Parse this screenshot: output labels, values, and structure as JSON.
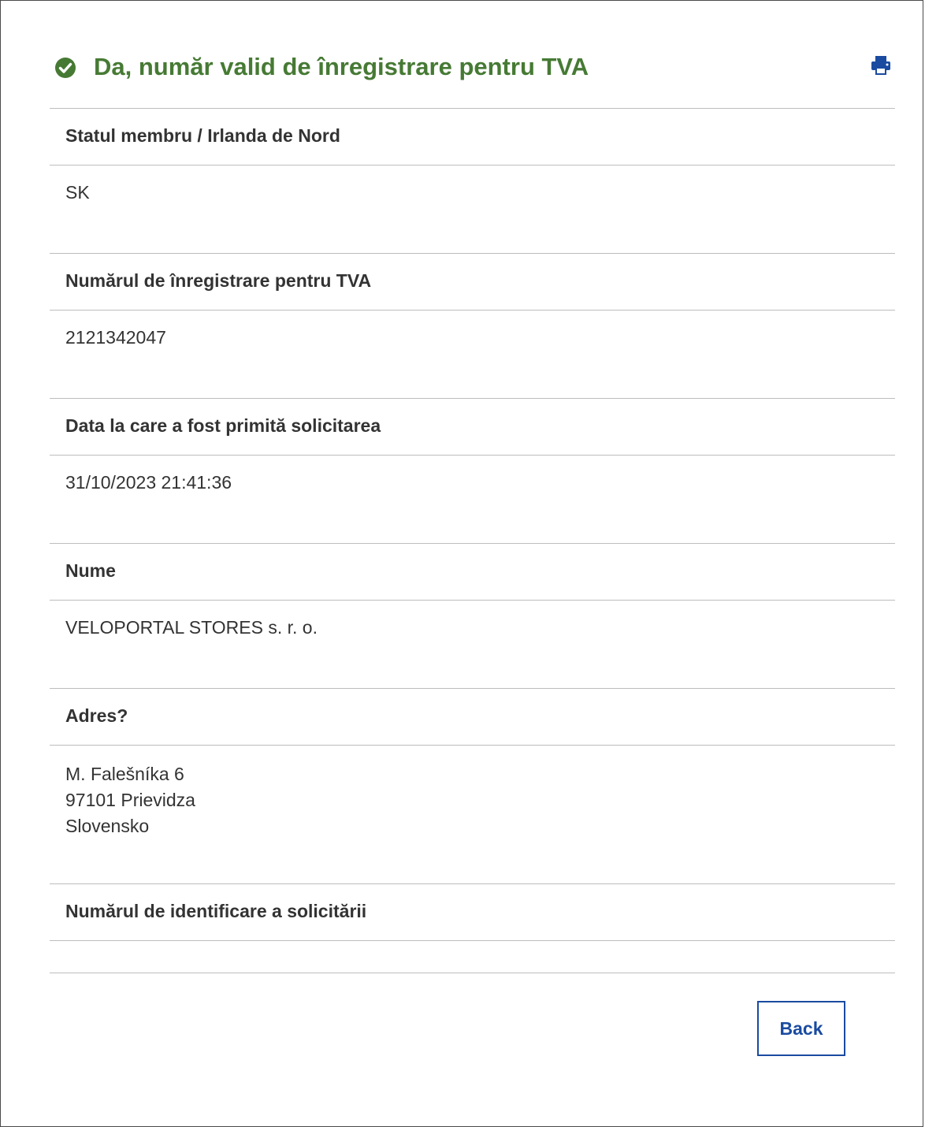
{
  "header": {
    "title": "Da, număr valid de înregistrare pentru TVA",
    "status_color": "#467a34",
    "status_icon": "check-circle-icon",
    "print_icon": "print-icon"
  },
  "fields": [
    {
      "label": "Statul membru / Irlanda de Nord",
      "value": "SK"
    },
    {
      "label": "Numărul de înregistrare pentru TVA",
      "value": "2121342047"
    },
    {
      "label": "Data la care a fost primită solicitarea",
      "value": "31/10/2023 21:41:36"
    },
    {
      "label": "Nume",
      "value": "VELOPORTAL STORES s. r. o."
    },
    {
      "label": "Adres?",
      "value": "M. Falešníka 6\n97101 Prievidza\nSlovensko"
    },
    {
      "label": "Numărul de identificare a solicitării",
      "value": ""
    }
  ],
  "actions": {
    "back_label": "Back",
    "accent_color": "#1a4ba0"
  }
}
